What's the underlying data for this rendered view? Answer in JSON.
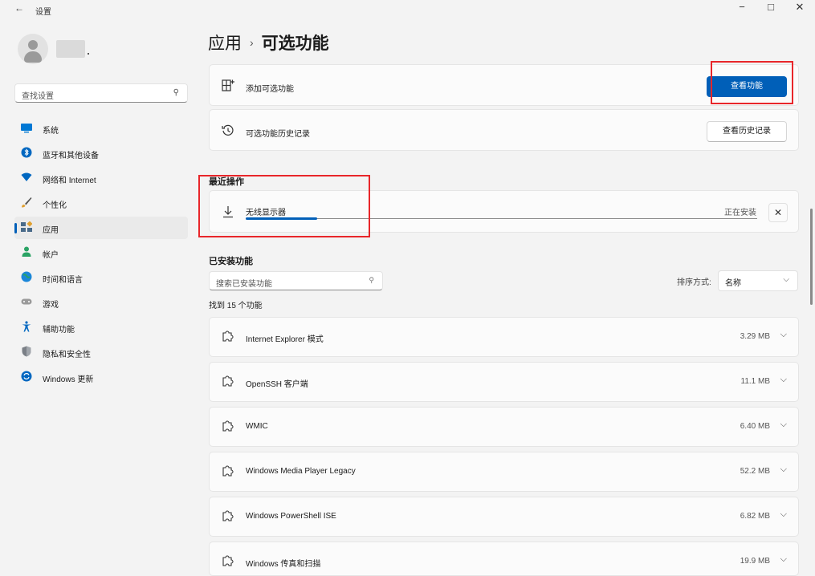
{
  "window": {
    "title": "设置",
    "back_icon": "←",
    "minimize": "−",
    "maximize": "□",
    "close": "✕"
  },
  "sidebar": {
    "search_placeholder": "查找设置",
    "search_icon": "⚲",
    "items": [
      {
        "label": "系统",
        "icon": "monitor-icon",
        "color": "#0078d4"
      },
      {
        "label": "蓝牙和其他设备",
        "icon": "bluetooth-icon",
        "color": "#0067c0"
      },
      {
        "label": "网络和 Internet",
        "icon": "wifi-icon",
        "color": "#0067c0"
      },
      {
        "label": "个性化",
        "icon": "brush-icon",
        "color": "#555555"
      },
      {
        "label": "应用",
        "icon": "apps-icon",
        "color": "#4a6b8a",
        "selected": true
      },
      {
        "label": "帐户",
        "icon": "person-icon",
        "color": "#2aa364"
      },
      {
        "label": "时间和语言",
        "icon": "globe-clock-icon",
        "color": "#1a86d9"
      },
      {
        "label": "游戏",
        "icon": "gamepad-icon",
        "color": "#8a8a8a"
      },
      {
        "label": "辅助功能",
        "icon": "accessibility-icon",
        "color": "#0067c0"
      },
      {
        "label": "隐私和安全性",
        "icon": "shield-icon",
        "color": "#7a7f86"
      },
      {
        "label": "Windows 更新",
        "icon": "update-icon",
        "color": "#0067c0"
      }
    ]
  },
  "header": {
    "parent": "应用",
    "separator": "›",
    "current": "可选功能"
  },
  "add_card": {
    "label": "添加可选功能",
    "button": "查看功能"
  },
  "history_card": {
    "label": "可选功能历史记录",
    "button": "查看历史记录"
  },
  "recent": {
    "heading": "最近操作",
    "item": "无线显示器",
    "status": "正在安装",
    "progress": 0.14,
    "cancel_icon": "✕"
  },
  "installed": {
    "heading": "已安装功能",
    "search_placeholder": "搜索已安装功能",
    "sort_label": "排序方式:",
    "sort_value": "名称",
    "found_text": "找到 15 个功能",
    "features": [
      {
        "name": "Internet Explorer 模式",
        "size": "3.29 MB"
      },
      {
        "name": "OpenSSH 客户端",
        "size": "11.1 MB"
      },
      {
        "name": "WMIC",
        "size": "6.40 MB"
      },
      {
        "name": "Windows Media Player Legacy",
        "size": "52.2 MB"
      },
      {
        "name": "Windows PowerShell ISE",
        "size": "6.82 MB"
      },
      {
        "name": "Windows 传真和扫描",
        "size": "19.9 MB"
      }
    ]
  },
  "colors": {
    "accent": "#005fb8",
    "highlight": "#e8262a"
  }
}
